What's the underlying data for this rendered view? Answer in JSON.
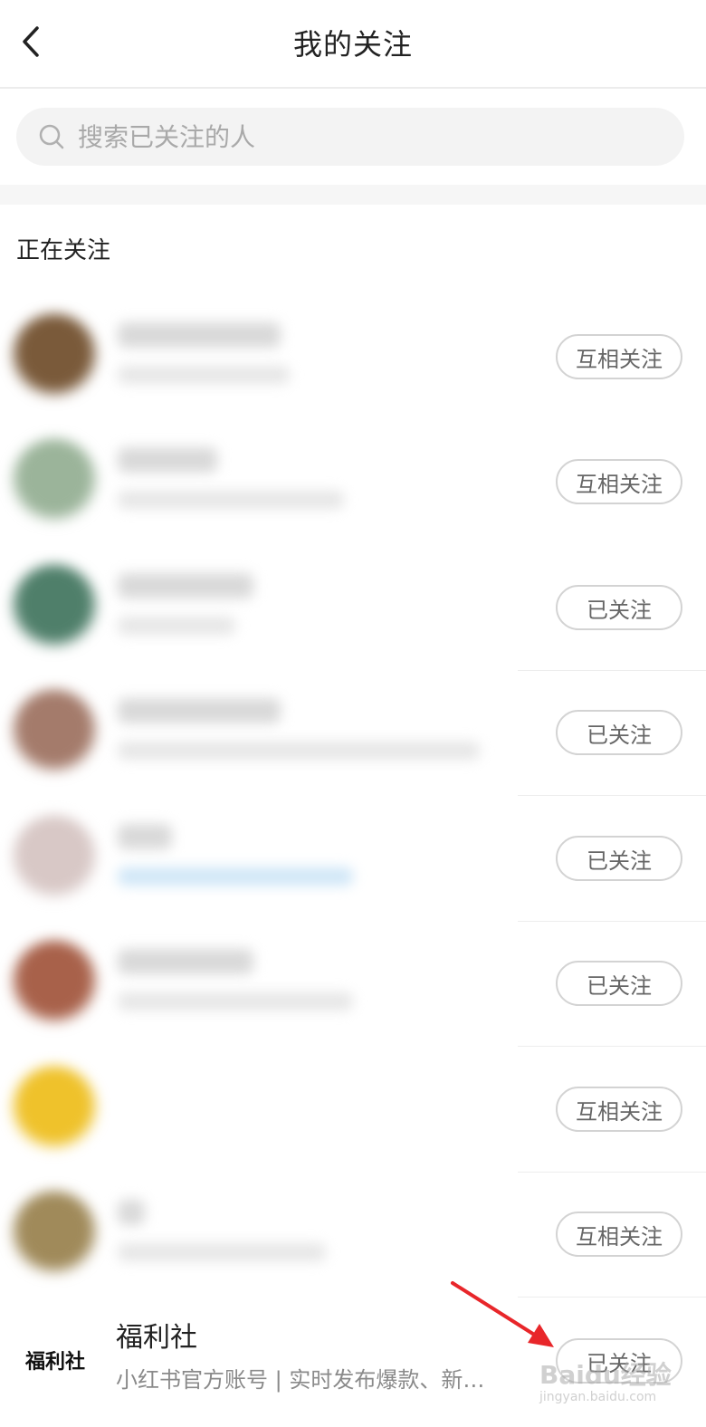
{
  "header": {
    "title": "我的关注",
    "back_icon": "chevron-left-icon"
  },
  "search": {
    "placeholder": "搜索已关注的人",
    "value": "",
    "icon": "search-icon"
  },
  "section": {
    "title": "正在关注"
  },
  "rows": [
    {
      "avatar_color": "#7a5a3a",
      "button": "互相关注"
    },
    {
      "avatar_color": "#9bb49a",
      "button": "互相关注"
    },
    {
      "avatar_color": "#4f7f6a",
      "button": "已关注"
    },
    {
      "avatar_color": "#a47b6b",
      "button": "已关注"
    },
    {
      "avatar_color": "#d8c8c6",
      "button": "已关注"
    },
    {
      "avatar_color": "#a8614a",
      "button": "已关注"
    },
    {
      "avatar_color": "#efc22b",
      "button": "互相关注"
    },
    {
      "avatar_color": "#a08a5a",
      "button": "互相关注"
    }
  ],
  "featured": {
    "logo_text": "福利社",
    "name": "福利社",
    "desc": "小红书官方账号 | 实时发布爆款、新…",
    "button": "已关注"
  },
  "watermark": {
    "line1": "Baidu经验",
    "line2": "jingyan.baidu.com"
  },
  "colors": {
    "annotation_arrow": "#e8262a"
  }
}
